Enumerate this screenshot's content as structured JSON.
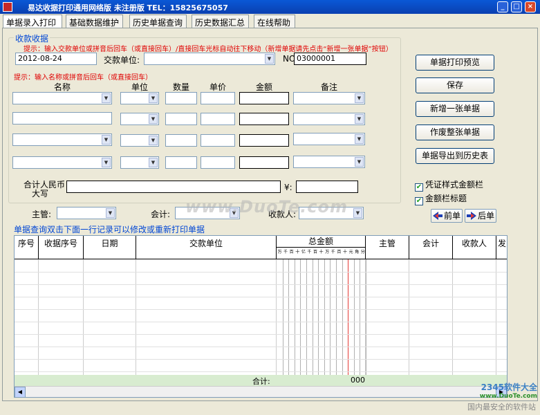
{
  "window": {
    "title": "易达收据打印通用网络版  未注册版    TEL：15825675057"
  },
  "tabs": [
    "单据录入打印",
    "基础数据维护",
    "历史单据查询",
    "历史数据汇总",
    "在线帮助"
  ],
  "receipt": {
    "group_title": "收款收据",
    "hint1": "提示：输入交款单位或拼音后回车（或直接回车）/直接回车光标自动往下移动（新增单据请先点击“新增一张单据”按钮）",
    "date": "2012-08-24",
    "payer_label": "交款单位:",
    "no_label": "NO.",
    "no_value": "03000001",
    "hint2": "提示：输入名称或拼音后回车（或直接回车）"
  },
  "item_columns": [
    "名称",
    "单位",
    "数量",
    "单价",
    "金额",
    "备注"
  ],
  "total": {
    "label_line1": "合计人民币",
    "label_line2": "大写",
    "yen": "¥:"
  },
  "signers": {
    "supervisor": "主管:",
    "accountant": "会计:",
    "cashier": "收款人:"
  },
  "actions": {
    "print_preview": "单据打印预览",
    "save": "保存",
    "new_receipt": "新增一张单据",
    "void_receipt": "作废整张单据",
    "export_history": "单据导出到历史表"
  },
  "options": {
    "voucher_style": "凭证样式金额栏",
    "amount_title": "金额栏标题"
  },
  "nav": {
    "prev": "前单",
    "next": "后单"
  },
  "grid": {
    "caption": "单据查询双击下面一行记录可以修改或重新打印单据",
    "columns": [
      "序号",
      "收据序号",
      "日期",
      "交款单位",
      "总金额",
      "主管",
      "会计",
      "收款人",
      "发"
    ],
    "digits": [
      "万",
      "千",
      "百",
      "十",
      "亿",
      "千",
      "百",
      "十",
      "万",
      "千",
      "百",
      "十",
      "元",
      "角",
      "分"
    ],
    "total_label": "合计:",
    "total_value": "000"
  },
  "watermark": {
    "text": "www.DuoTe.com",
    "brand": "2345软件大全",
    "brand_url": "www.DuoTe.com",
    "slogan": "国内最安全的软件站"
  },
  "colors": {
    "title_bar": "#0a48c8",
    "hint_red": "#e00000",
    "group_blue": "#0046d5"
  }
}
